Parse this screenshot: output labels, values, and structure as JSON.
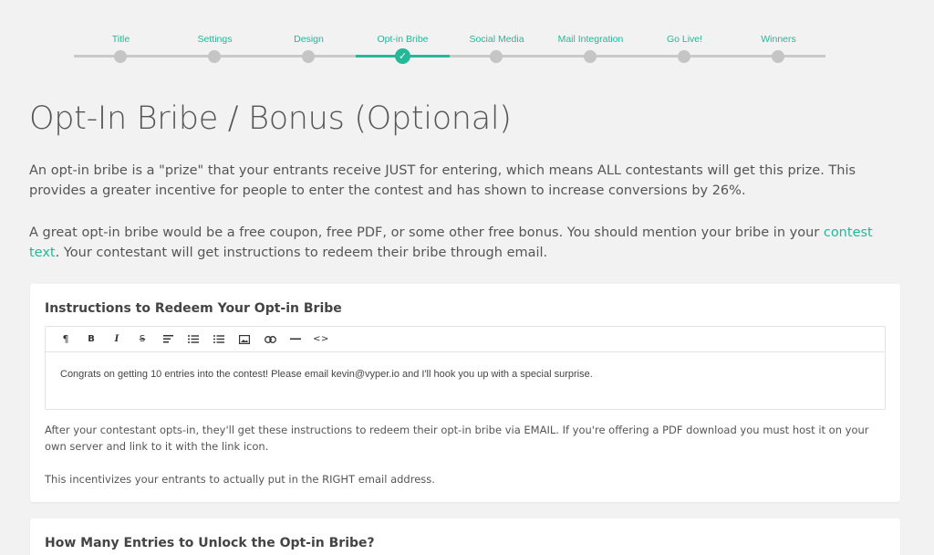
{
  "stepper": {
    "steps": [
      {
        "label": "Title",
        "state": "pending"
      },
      {
        "label": "Settings",
        "state": "pending"
      },
      {
        "label": "Design",
        "state": "pending"
      },
      {
        "label": "Opt-in Bribe",
        "state": "active"
      },
      {
        "label": "Social Media",
        "state": "pending"
      },
      {
        "label": "Mail Integration",
        "state": "pending"
      },
      {
        "label": "Go Live!",
        "state": "pending"
      },
      {
        "label": "Winners",
        "state": "pending"
      }
    ],
    "active_check": "✓",
    "accent_color": "#25b797"
  },
  "page": {
    "title": "Opt-In Bribe / Bonus (Optional)",
    "intro_1": "An opt-in bribe is a \"prize\" that your entrants receive JUST for entering, which means ALL contestants will get this prize. This provides a greater incentive for people to enter the contest and has shown to increase conversions by 26%.",
    "intro_2_before": "A great opt-in bribe would be a free coupon, free PDF, or some other free bonus. You should mention your bribe in your ",
    "intro_2_link": "contest text",
    "intro_2_after": ". Your contestant will get instructions to redeem their bribe through email."
  },
  "instructions_card": {
    "title": "Instructions to Redeem Your Opt-in Bribe",
    "toolbar": [
      {
        "name": "paragraph-icon",
        "glyph": "¶"
      },
      {
        "name": "bold-icon",
        "glyph": "B"
      },
      {
        "name": "italic-icon",
        "glyph": "I"
      },
      {
        "name": "strikethrough-icon",
        "glyph": "S"
      },
      {
        "name": "align-left-icon",
        "glyph": ""
      },
      {
        "name": "unordered-list-icon",
        "glyph": ""
      },
      {
        "name": "ordered-list-icon",
        "glyph": ""
      },
      {
        "name": "image-icon",
        "glyph": ""
      },
      {
        "name": "link-icon",
        "glyph": ""
      },
      {
        "name": "horizontal-rule-icon",
        "glyph": ""
      },
      {
        "name": "code-icon",
        "glyph": "<>"
      }
    ],
    "editor_text": "Congrats on getting 10 entries into the contest! Please email kevin@vyper.io and I'll hook you up with a special surprise.",
    "help_1": "After your contestant opts-in, they'll get these instructions to redeem their opt-in bribe via EMAIL. If you're offering a PDF download you must host it on your own server and link to it with the link icon.",
    "help_2": "This incentivizes your entrants to actually put in the RIGHT email address."
  },
  "entries_card": {
    "title": "How Many Entries to Unlock the Opt-in Bribe?"
  }
}
